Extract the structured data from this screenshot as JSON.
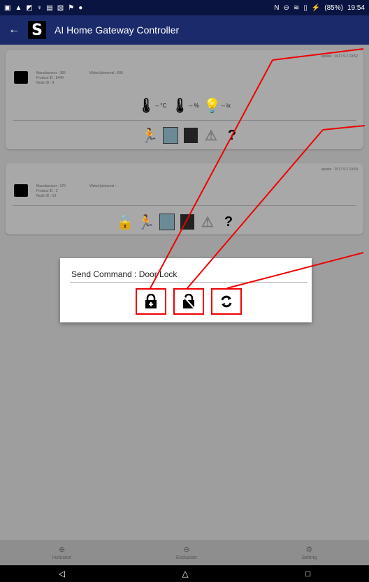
{
  "status_bar": {
    "left_icons": [
      "notification-icon",
      "alert-icon",
      "image-icon",
      "usb-icon",
      "sim-icon",
      "picture-icon",
      "flag-icon",
      "dot-icon"
    ],
    "battery": "(85%)",
    "time": "19:54"
  },
  "app_bar": {
    "logo": "S",
    "title": "AI Home Gateway Controller"
  },
  "devices": [
    {
      "update": "update : 2017.9.2 19:52",
      "manufacturer": "Manufacturer : 365",
      "product_id": "Product ID : 8449",
      "node_id": "Node ID : 9",
      "wake": "WakeUpInterval : 600",
      "sensors": [
        {
          "unit": "°C",
          "value": "--"
        },
        {
          "unit": "%",
          "value": "--"
        },
        {
          "unit": "lx",
          "value": "--"
        }
      ]
    },
    {
      "update": "update : 2017.9.2 19:54",
      "manufacturer": "Manufacturer : 370",
      "product_id": "Product ID : 2",
      "node_id": "Node ID : 10",
      "wake": "WakeUpInterval :"
    }
  ],
  "dialog": {
    "title": "Send Command : Door Lock",
    "commands": [
      "lock-icon",
      "unlock-icon",
      "refresh-icon"
    ]
  },
  "bottom_nav": [
    {
      "label": "Inclusion",
      "icon": "plus-circle-icon"
    },
    {
      "label": "Exclusion",
      "icon": "minus-circle-icon"
    },
    {
      "label": "Setting",
      "icon": "gear-icon"
    }
  ],
  "system_nav": {
    "back": "◁",
    "home": "△",
    "recents": "□"
  },
  "colors": {
    "app_bar": "#1a2a6a",
    "annotation": "#e00000",
    "overlay": "#9e9e9e"
  }
}
